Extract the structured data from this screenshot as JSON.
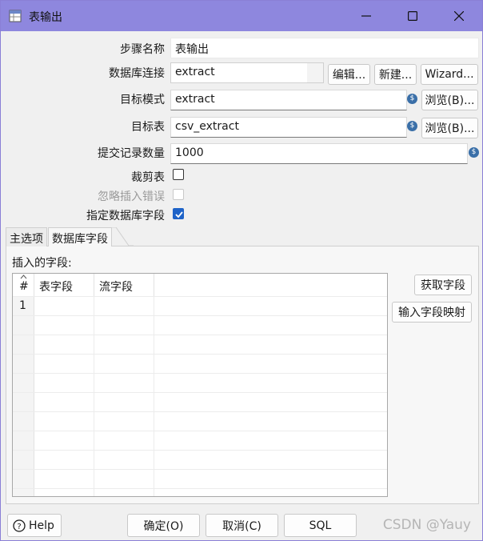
{
  "window": {
    "title": "表输出"
  },
  "form": {
    "step_name_label": "步骤名称",
    "step_name_value": "表输出",
    "db_conn_label": "数据库连接",
    "db_conn_value": "extract",
    "edit_btn": "编辑...",
    "new_btn": "新建...",
    "wizard_btn": "Wizard...",
    "schema_label": "目标模式",
    "schema_value": "extract",
    "browse_btn_1": "浏览(B)...",
    "table_label": "目标表",
    "table_value": "csv_extract",
    "browse_btn_2": "浏览(B)...",
    "commit_label": "提交记录数量",
    "commit_value": "1000",
    "truncate_label": "裁剪表",
    "truncate_checked": false,
    "ignore_errors_label": "忽略插入错误",
    "ignore_errors_checked": false,
    "specify_fields_label": "指定数据库字段",
    "specify_fields_checked": true,
    "var_icon_glyph": "$"
  },
  "tabs": [
    {
      "label": "主选项",
      "active": false
    },
    {
      "label": "数据库字段",
      "active": true
    }
  ],
  "fields_panel": {
    "section_label": "插入的字段:",
    "columns": [
      "#",
      "表字段",
      "流字段"
    ],
    "rows": [
      {
        "num": "1",
        "table_field": "",
        "stream_field": ""
      }
    ],
    "get_fields_btn": "获取字段",
    "mapping_btn": "输入字段映射"
  },
  "footer": {
    "help_btn": "Help",
    "ok_btn": "确定(O)",
    "cancel_btn": "取消(C)",
    "sql_btn": "SQL",
    "watermark": "CSDN @Yauy"
  },
  "colors": {
    "titlebar": "#8e87de",
    "check_accent": "#1e63c8",
    "var_icon": "#3a6fa8"
  },
  "icons": [
    "table-output-icon",
    "minimize-icon",
    "maximize-icon",
    "close-icon",
    "variable-icon",
    "checkmark-icon",
    "sort-arrow-icon",
    "help-icon"
  ]
}
